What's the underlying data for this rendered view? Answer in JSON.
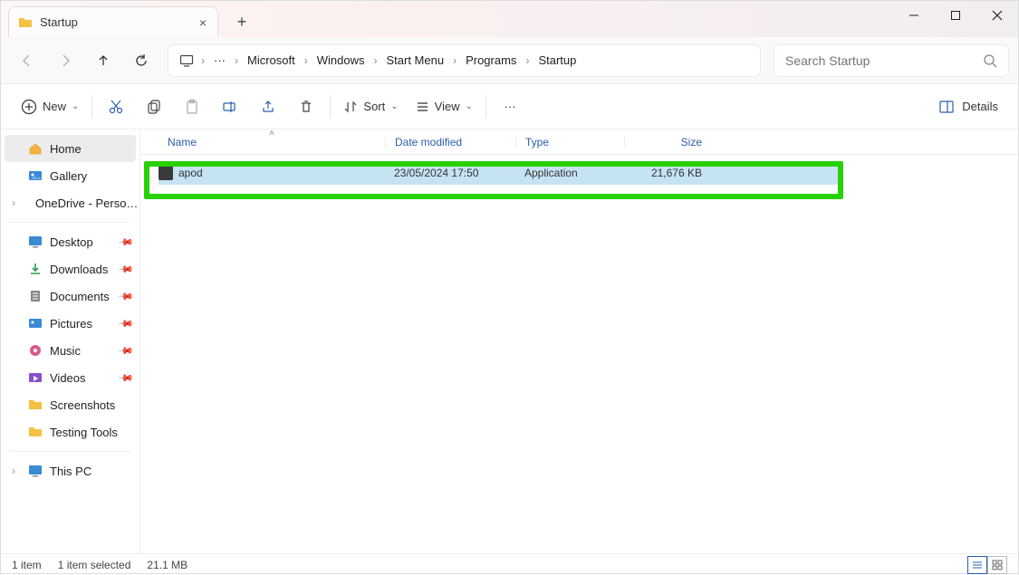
{
  "window_title": "Startup",
  "breadcrumbs": [
    "Microsoft",
    "Windows",
    "Start Menu",
    "Programs",
    "Startup"
  ],
  "search": {
    "placeholder": "Search Startup"
  },
  "toolbar": {
    "new_label": "New",
    "sort_label": "Sort",
    "view_label": "View",
    "details_label": "Details"
  },
  "sidebar": {
    "home": "Home",
    "gallery": "Gallery",
    "onedrive": "OneDrive - Perso…",
    "pinned": [
      "Desktop",
      "Downloads",
      "Documents",
      "Pictures",
      "Music",
      "Videos"
    ],
    "folders": [
      "Screenshots",
      "Testing Tools"
    ],
    "thispc": "This PC"
  },
  "columns": {
    "name": "Name",
    "date": "Date modified",
    "type": "Type",
    "size": "Size"
  },
  "files": [
    {
      "name": "apod",
      "date": "23/05/2024 17:50",
      "type": "Application",
      "size": "21,676 KB"
    }
  ],
  "status": {
    "count": "1 item",
    "selected": "1 item selected",
    "size": "21.1 MB"
  }
}
